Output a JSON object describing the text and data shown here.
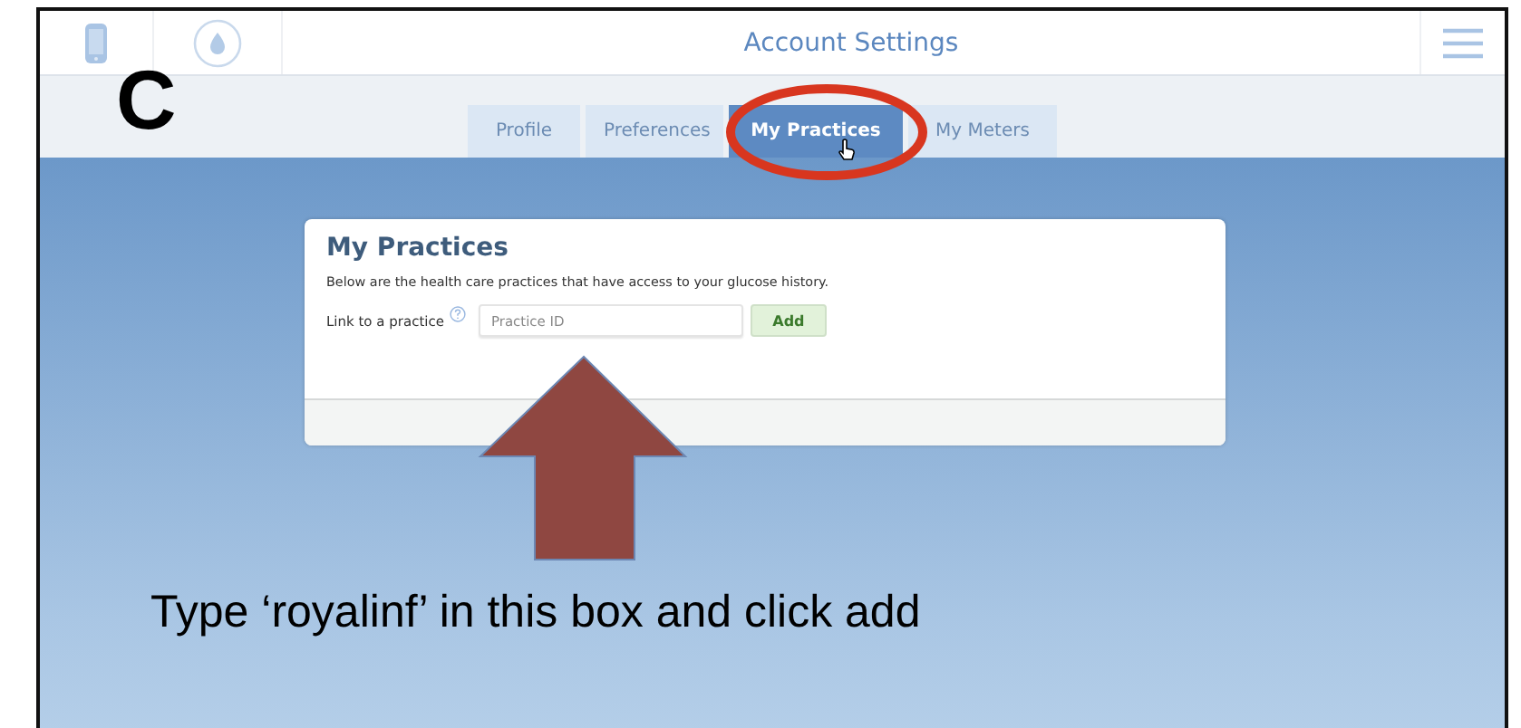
{
  "header": {
    "title": "Account Settings"
  },
  "tabs": [
    {
      "label": "Profile",
      "selected": false
    },
    {
      "label": "Preferences",
      "selected": false
    },
    {
      "label": "My Practices",
      "selected": true
    },
    {
      "label": "My Meters",
      "selected": false
    }
  ],
  "card": {
    "title": "My Practices",
    "description": "Below are the health care practices that have access to your glucose history.",
    "link_label": "Link to a practice",
    "field": {
      "placeholder": "Practice ID"
    },
    "button": "Add"
  },
  "annotations": {
    "step_letter": "C",
    "instruction": "Type ‘royalinf’ in this box and click add"
  }
}
